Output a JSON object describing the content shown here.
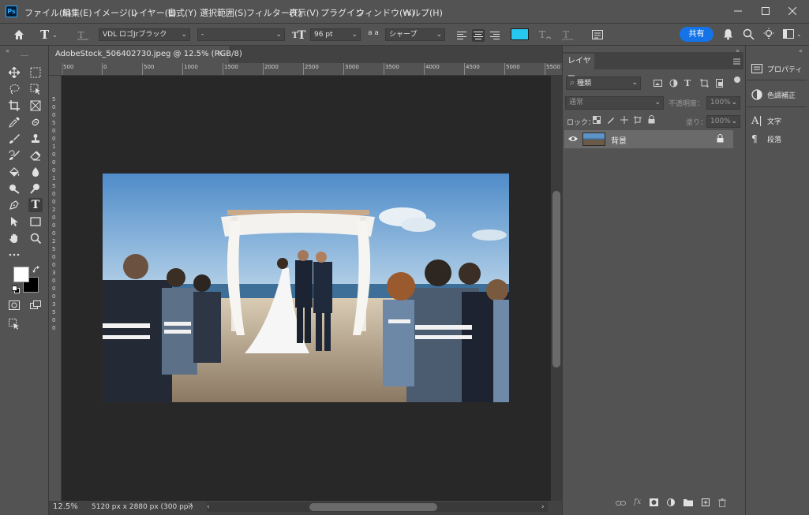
{
  "app": {
    "logo": "Ps"
  },
  "menu": [
    "ファイル(F)",
    "編集(E)",
    "イメージ(I)",
    "レイヤー(L)",
    "書式(Y)",
    "選択範囲(S)",
    "フィルター(T)",
    "表示(V)",
    "プラグイン",
    "ウィンドウ(W)",
    "ヘルプ(H)"
  ],
  "options": {
    "tool_icon": "type-tool-icon",
    "font_family": "VDL ロゴJrブラック",
    "font_style": "-",
    "font_size": "96 pt",
    "aa_icon": "a a",
    "antialias": "シャープ",
    "text_color": "#26c8f0",
    "share_label": "共有"
  },
  "document": {
    "tab_title": "AdobeStock_506402730.jpeg @ 12.5% (RGB/8)",
    "zoom": "12.5%",
    "info": "5120 px x 2880 px (300 ppi)",
    "ruler_top": [
      "500",
      "0",
      "500",
      "1000",
      "1500",
      "2000",
      "2500",
      "3000",
      "3500",
      "4000",
      "4500",
      "5000",
      "5500"
    ],
    "ruler_left": [
      "5",
      "0",
      "0",
      "5",
      "0",
      "0",
      "1",
      "0",
      "0",
      "0",
      "1",
      "5",
      "0",
      "0",
      "2",
      "0",
      "0",
      "0",
      "2",
      "5",
      "0",
      "0",
      "3",
      "0",
      "0",
      "0",
      "3",
      "5",
      "0",
      "0"
    ]
  },
  "layers_panel": {
    "tab": "レイヤー",
    "filter_placeholder": "種類",
    "blend_mode": "通常",
    "opacity_label": "不透明度：",
    "opacity_value": "100%",
    "lock_label": "ロック：",
    "fill_label": "塗り：",
    "fill_value": "100%",
    "layers": [
      {
        "name": "背景",
        "visible": true,
        "locked": true
      }
    ]
  },
  "dock": [
    {
      "label": "プロパティ",
      "icon": "properties-icon"
    },
    {
      "label": "色調補正",
      "icon": "adjustments-icon"
    },
    {
      "label": "文字",
      "icon": "character-icon"
    },
    {
      "label": "段落",
      "icon": "paragraph-icon"
    }
  ],
  "colors": {
    "foreground": "#ffffff",
    "background": "#000000",
    "accent": "#1473e6"
  }
}
